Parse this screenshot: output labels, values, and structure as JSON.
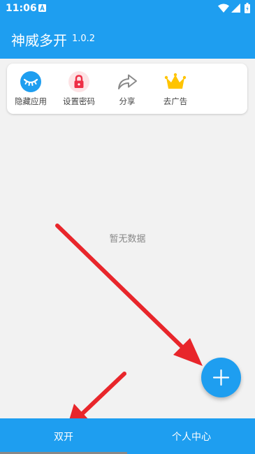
{
  "status_bar": {
    "time": "11:06",
    "icons": [
      "notification-a-icon",
      "wifi-icon",
      "signal-icon",
      "battery-icon"
    ]
  },
  "app_bar": {
    "title": "神威多开",
    "version": "1.0.2"
  },
  "toolbar": {
    "items": [
      {
        "label": "隐藏应用",
        "icon": "eye-closed-icon"
      },
      {
        "label": "设置密码",
        "icon": "lock-icon"
      },
      {
        "label": "分享",
        "icon": "share-icon"
      },
      {
        "label": "去广告",
        "icon": "crown-icon"
      }
    ]
  },
  "main": {
    "empty_text": "暂无数据"
  },
  "fab": {
    "icon": "plus-icon"
  },
  "bottom_nav": {
    "items": [
      {
        "label": "双开",
        "selected": true
      },
      {
        "label": "个人中心",
        "selected": false
      }
    ]
  },
  "colors": {
    "primary": "#1e9ef0",
    "background": "#f2f2f2",
    "annotation_arrow": "#e8262b"
  }
}
